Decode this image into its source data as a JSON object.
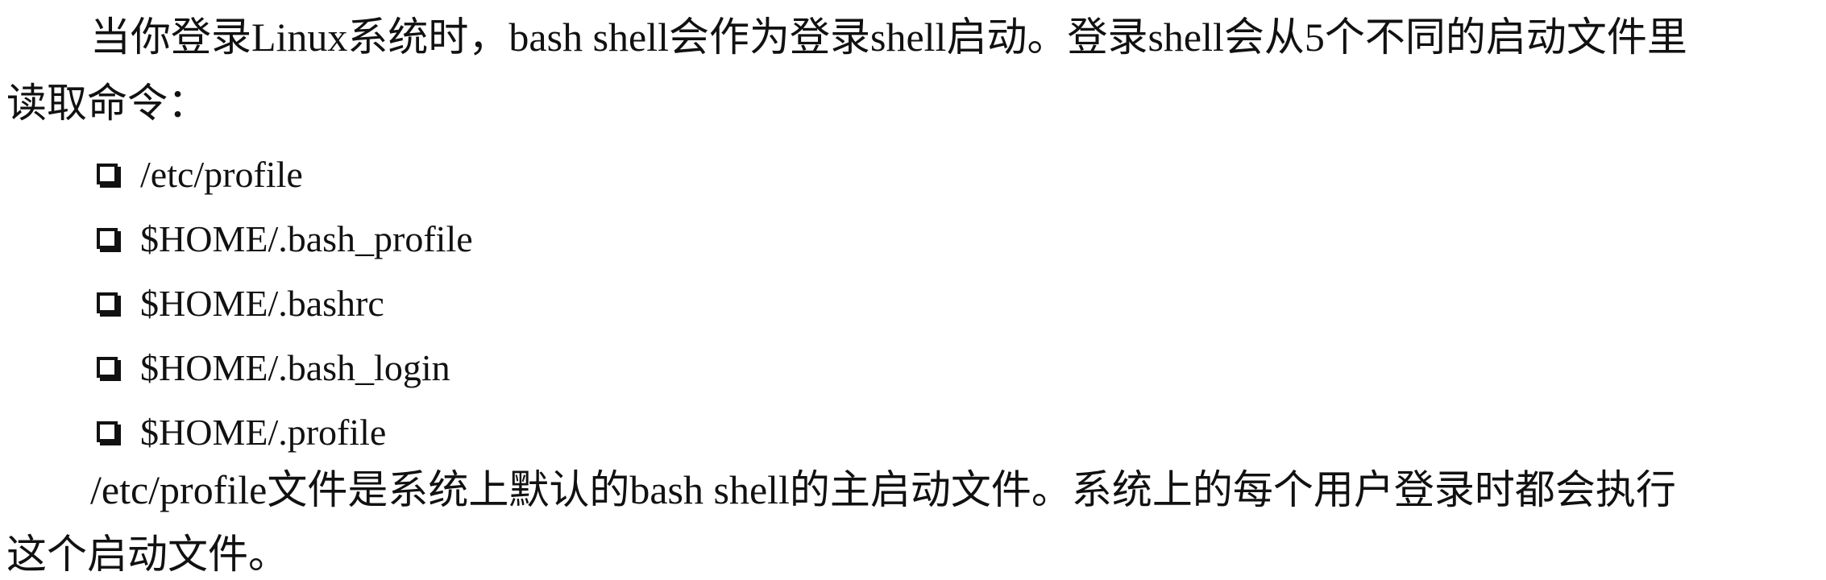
{
  "paragraph1": {
    "line1": "当你登录Linux系统时，bash shell会作为登录shell启动。登录shell会从5个不同的启动文件里",
    "line2": "读取命令："
  },
  "startup_files": [
    "/etc/profile",
    "$HOME/.bash_profile",
    "$HOME/.bashrc",
    "$HOME/.bash_login",
    "$HOME/.profile"
  ],
  "paragraph2": {
    "line1": "/etc/profile文件是系统上默认的bash shell的主启动文件。系统上的每个用户登录时都会执行",
    "line2": "这个启动文件。"
  }
}
